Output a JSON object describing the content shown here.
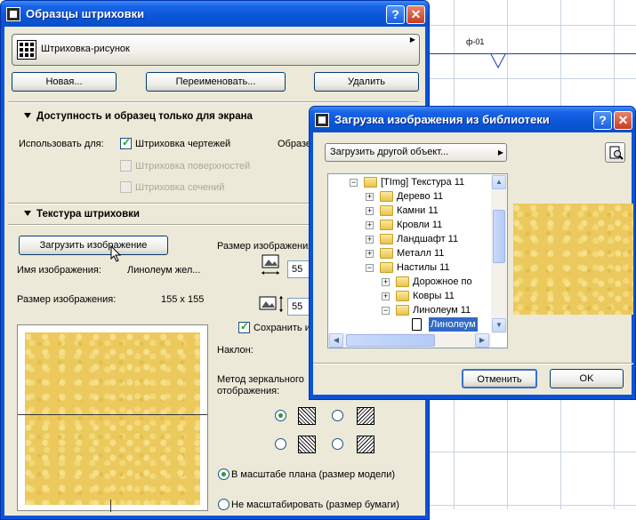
{
  "canvas": {
    "marker_label": "ф-01"
  },
  "hatch_window": {
    "title": "Образцы штриховки",
    "help_btn": "?",
    "close_btn": "✕",
    "hatch_type": "Штриховка-рисунок",
    "buttons": {
      "new": "Новая...",
      "rename": "Переименовать...",
      "delete": "Удалить"
    },
    "section_availability": "Доступность и образец только для экрана",
    "use_for_label": "Использовать для:",
    "sample_label": "Образе",
    "checkboxes": [
      {
        "label": "Штриховка чертежей",
        "checked": true,
        "enabled": true
      },
      {
        "label": "Штриховка поверхностей",
        "checked": false,
        "enabled": false
      },
      {
        "label": "Штриховка сечений",
        "checked": false,
        "enabled": false
      }
    ],
    "section_texture": "Текстура штриховки",
    "load_image_btn": "Загрузить изображение",
    "image_name_label": "Имя изображения:",
    "image_name_value": "Линолеум  жел...",
    "image_size_label": "Размер изображения:",
    "image_size_value": "155 x 155",
    "image_size_right_label": "Размер изображения",
    "width_value": "55",
    "height_value": "55",
    "keep_ratio_label": "Сохранить ис",
    "keep_ratio_checked": true,
    "tilt_label": "Наклон:",
    "mirror_label_1": "Метод зеркального",
    "mirror_label_2": "отображения:",
    "mirror_selected_index": 0,
    "scale_options": [
      {
        "label": "В масштабе плана (размер модели)",
        "selected": true
      },
      {
        "label": "Не масштабировать (размер бумаги)",
        "selected": false
      }
    ]
  },
  "load_dialog": {
    "title": "Загрузка изображения из библиотеки",
    "help_btn": "?",
    "close_btn": "✕",
    "load_other": "Загрузить другой объект...",
    "tree": [
      {
        "label": "[TImg] Текстура 11",
        "level": 0,
        "expander": "−"
      },
      {
        "label": "Дерево 11",
        "level": 1,
        "expander": "+"
      },
      {
        "label": "Камни 11",
        "level": 1,
        "expander": "+"
      },
      {
        "label": "Кровли 11",
        "level": 1,
        "expander": "+"
      },
      {
        "label": "Ландшафт 11",
        "level": 1,
        "expander": "+"
      },
      {
        "label": "Металл 11",
        "level": 1,
        "expander": "+"
      },
      {
        "label": "Настилы 11",
        "level": 1,
        "expander": "−"
      },
      {
        "label": "Дорожное по",
        "level": 2,
        "expander": "+"
      },
      {
        "label": "Ковры 11",
        "level": 2,
        "expander": "+"
      },
      {
        "label": "Линолеум 11",
        "level": 2,
        "expander": "−"
      },
      {
        "label": "Линолеум",
        "level": 3,
        "expander": "",
        "selected": true
      }
    ],
    "buttons": {
      "cancel": "Отменить",
      "ok": "OK"
    }
  }
}
